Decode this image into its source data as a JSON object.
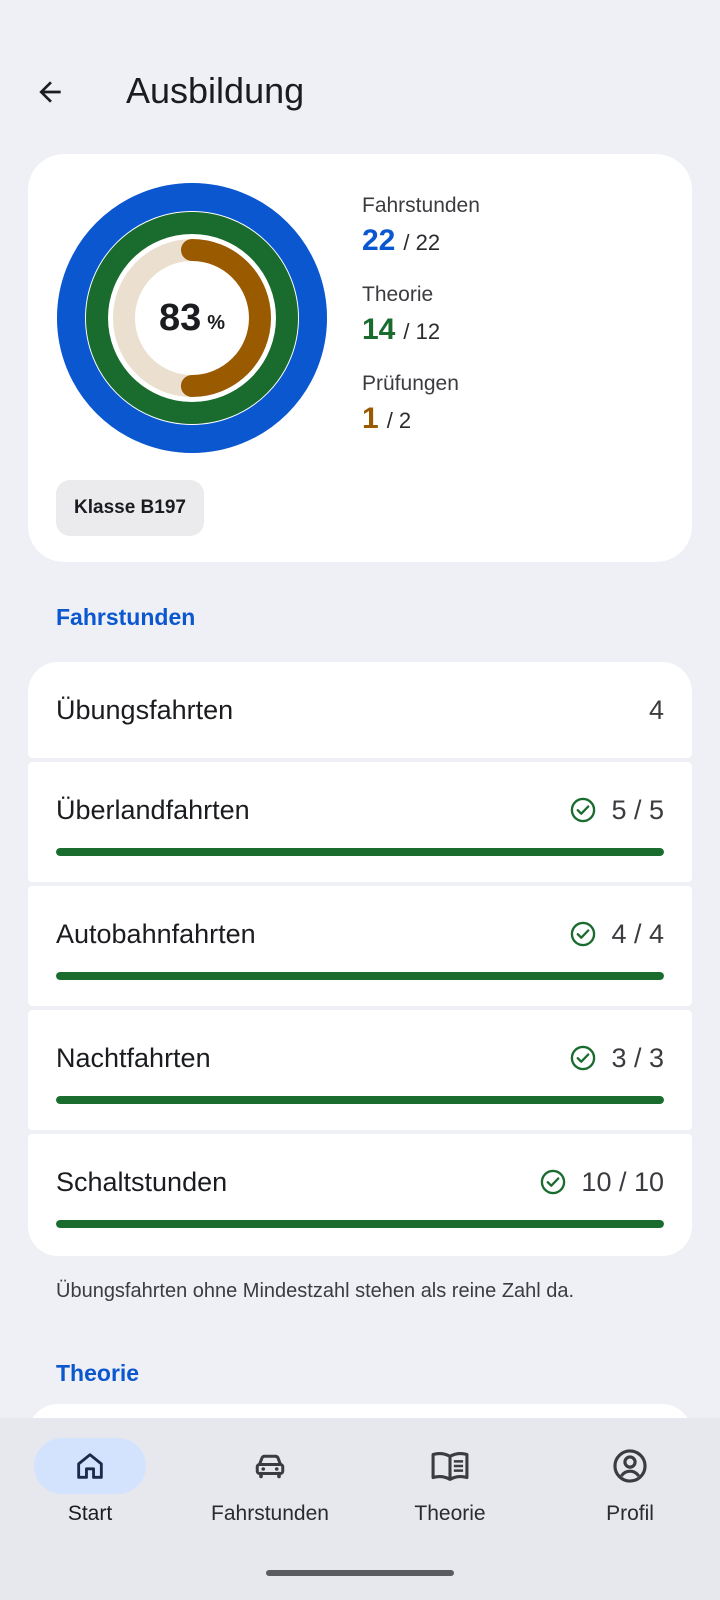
{
  "header": {
    "title": "Ausbildung",
    "back_icon": "arrow-left-icon"
  },
  "summary": {
    "percent": "83",
    "percent_unit": "%",
    "rings": [
      {
        "name": "Fahrstunden",
        "color": "#0b57d0",
        "fraction": 1.0
      },
      {
        "name": "Theorie",
        "color": "#1a6b2e",
        "fraction": 1.0
      },
      {
        "name": "Prüfungen",
        "color": "#9a5a00",
        "fraction": 0.5
      }
    ],
    "stats": [
      {
        "label": "Fahrstunden",
        "value": "22",
        "total": "/ 22",
        "color": "#0b57d0"
      },
      {
        "label": "Theorie",
        "value": "14",
        "total": "/ 12",
        "color": "#1a6b2e"
      },
      {
        "label": "Prüfungen",
        "value": "1",
        "total": "/ 2",
        "color": "#9a5a00"
      }
    ],
    "class_chip": "Klasse B197"
  },
  "fahrstunden_section": {
    "title": "Fahrstunden",
    "items": [
      {
        "label": "Übungsfahrten",
        "value": "4",
        "has_progress": false
      },
      {
        "label": "Überlandfahrten",
        "value": "5 / 5",
        "has_progress": true,
        "progress": 1.0,
        "icon": "check-circle-icon"
      },
      {
        "label": "Autobahnfahrten",
        "value": "4 / 4",
        "has_progress": true,
        "progress": 1.0,
        "icon": "check-circle-icon"
      },
      {
        "label": "Nachtfahrten",
        "value": "3 / 3",
        "has_progress": true,
        "progress": 1.0,
        "icon": "check-circle-icon"
      },
      {
        "label": "Schaltstunden",
        "value": "10 / 10",
        "has_progress": true,
        "progress": 1.0,
        "icon": "check-circle-icon"
      }
    ],
    "footnote": "Übungsfahrten ohne Mindestzahl stehen als reine Zahl da."
  },
  "theorie_section": {
    "title": "Theorie"
  },
  "bottom_nav": {
    "items": [
      {
        "label": "Start",
        "icon": "home-icon",
        "active": true
      },
      {
        "label": "Fahrstunden",
        "icon": "car-icon",
        "active": false
      },
      {
        "label": "Theorie",
        "icon": "book-icon",
        "active": false
      },
      {
        "label": "Profil",
        "icon": "profile-icon",
        "active": false
      }
    ]
  },
  "colors": {
    "accent": "#0b57d0",
    "success": "#1a6b2e",
    "warning": "#9a5a00",
    "background": "#eef0f5"
  }
}
